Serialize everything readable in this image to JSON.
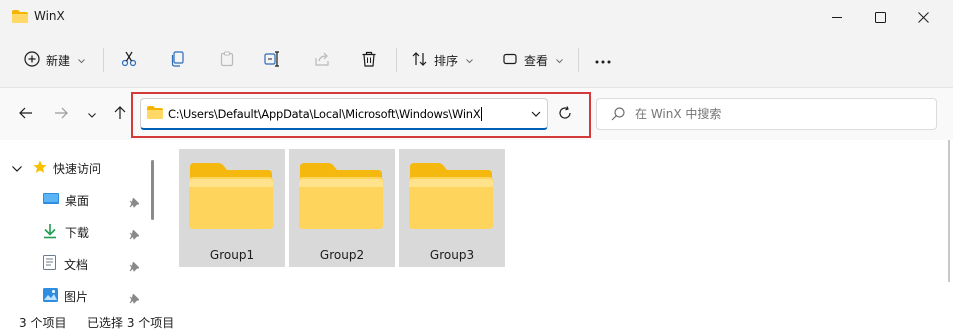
{
  "window": {
    "title": "WinX"
  },
  "toolbar": {
    "new_label": "新建",
    "sort_label": "排序",
    "view_label": "查看"
  },
  "address": {
    "path": "C:\\Users\\Default\\AppData\\Local\\Microsoft\\Windows\\WinX"
  },
  "search": {
    "placeholder": "在 WinX 中搜索"
  },
  "sidebar": {
    "items": [
      {
        "label": "快速访问",
        "icon": "star-icon"
      },
      {
        "label": "桌面",
        "icon": "desktop-icon"
      },
      {
        "label": "下载",
        "icon": "download-icon"
      },
      {
        "label": "文档",
        "icon": "document-icon"
      },
      {
        "label": "图片",
        "icon": "pictures-icon"
      }
    ]
  },
  "files": [
    {
      "name": "Group1"
    },
    {
      "name": "Group2"
    },
    {
      "name": "Group3"
    }
  ],
  "status": {
    "item_count": "3 个项目",
    "selected": "已选择 3 个项目"
  },
  "colors": {
    "folder": "#ffc83d",
    "folder_light": "#ffe08a",
    "highlight": "#d43a3a",
    "accent": "#005fb8"
  }
}
